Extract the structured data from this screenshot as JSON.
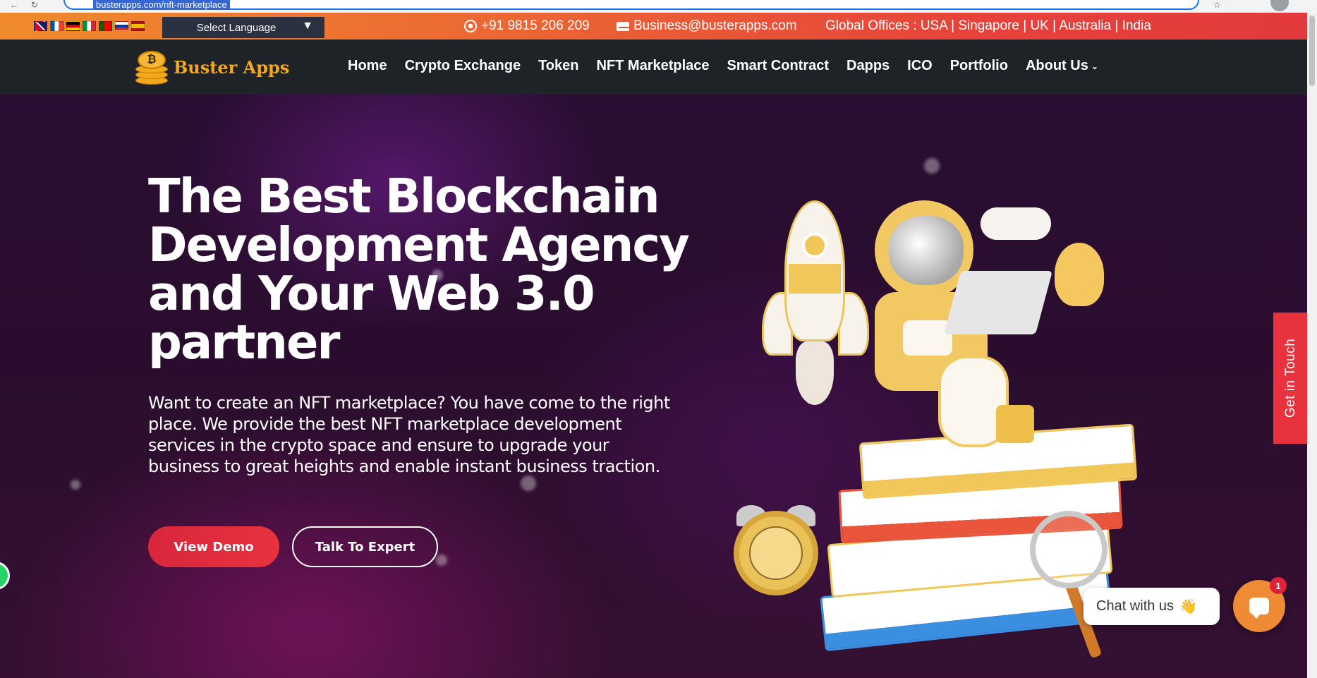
{
  "browser": {
    "url": "busterapps.com/nft-marketplace"
  },
  "topbar": {
    "flags": [
      "en",
      "fr",
      "de",
      "it",
      "pt",
      "ru",
      "es"
    ],
    "language_select": "Select Language",
    "language_arrow": "▼",
    "phone": "+91 9815 206 209",
    "email": "Business@busterapps.com",
    "offices": "Global Offices : USA | Singapore | UK | Australia | India"
  },
  "nav": {
    "logo_text": "Buster Apps",
    "logo_symbol": "₿",
    "links": [
      "Home",
      "Crypto Exchange",
      "Token",
      "NFT Marketplace",
      "Smart Contract",
      "Dapps",
      "ICO",
      "Portfolio",
      "About Us"
    ],
    "about_chevron": "⌄"
  },
  "hero": {
    "title": "The Best Blockchain Development Agency and Your Web 3.0 partner",
    "description": "Want to create an NFT marketplace? You have come to the right place. We provide the best NFT marketplace development services in the crypto space and ensure to upgrade your business to great heights and enable instant business traction.",
    "primary_button": "View Demo",
    "secondary_button": "Talk To Expert"
  },
  "side_tab": {
    "label": "Get in Touch"
  },
  "chat": {
    "label": "Chat with us",
    "wave": "👋",
    "badge_count": "1"
  },
  "colors": {
    "accent_red": "#e8323e",
    "brand_orange": "#f2a81d",
    "nav_bg": "#1f2227",
    "chat_orange": "#f08b35"
  },
  "icons": [
    "whatsapp-icon",
    "mail-icon",
    "chevron-down-icon",
    "chat-icon",
    "logo-coin-icon"
  ]
}
